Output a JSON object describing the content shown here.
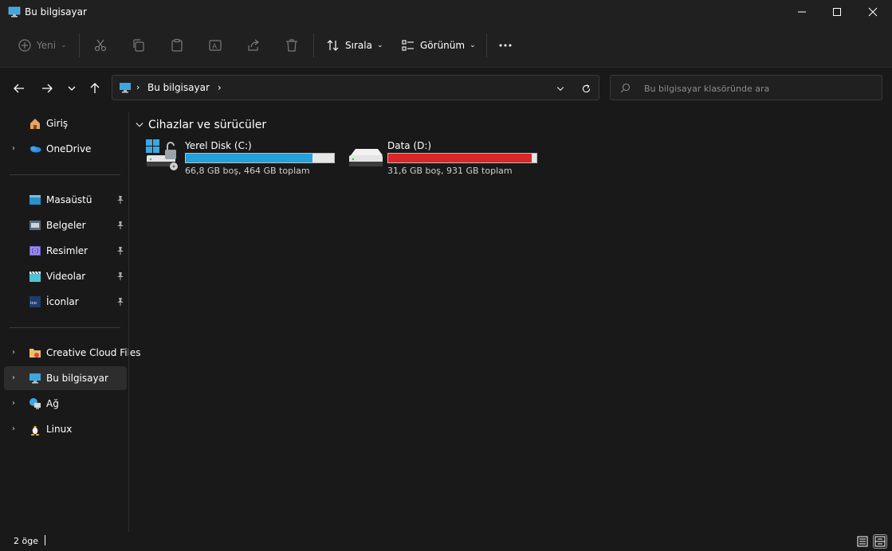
{
  "window": {
    "title": "Bu bilgisayar",
    "controls": [
      "minimize-icon",
      "maximize-icon",
      "close-icon"
    ]
  },
  "toolbar": {
    "new_label": "Yeni",
    "sort_label": "Sırala",
    "view_label": "Görünüm",
    "disabled_actions": [
      "cut-icon",
      "copy-icon",
      "paste-icon",
      "rename-icon",
      "share-icon",
      "delete-icon"
    ],
    "more_icon": "ellipsis-icon"
  },
  "address": {
    "segments": [
      "Bu bilgisayar"
    ],
    "search_placeholder": "Bu bilgisayar klasöründe ara"
  },
  "sidebar": {
    "items": [
      {
        "label": "Giriş",
        "icon": "home-icon"
      },
      {
        "label": "OneDrive",
        "icon": "onedrive-icon"
      },
      {
        "label": "Masaüstü",
        "icon": "desktop-icon",
        "pinned": true
      },
      {
        "label": "Belgeler",
        "icon": "documents-icon",
        "pinned": true
      },
      {
        "label": "Resimler",
        "icon": "pictures-icon",
        "pinned": true
      },
      {
        "label": "Videolar",
        "icon": "videos-icon",
        "pinned": true
      },
      {
        "label": "İconlar",
        "icon": "ico-folder-icon",
        "pinned": true
      },
      {
        "label": "Creative Cloud Files",
        "icon": "creative-cloud-icon"
      },
      {
        "label": "Bu bilgisayar",
        "icon": "this-pc-icon",
        "selected": true
      },
      {
        "label": "Ağ",
        "icon": "network-icon"
      },
      {
        "label": "Linux",
        "icon": "linux-icon"
      }
    ]
  },
  "content": {
    "group_title": "Cihazlar ve sürücüler",
    "drives": [
      {
        "name": "Yerel Disk (C:)",
        "info": "66,8 GB boş, 464 GB toplam",
        "used_fraction": 0.856,
        "bar_color": "#26a0da"
      },
      {
        "name": "Data (D:)",
        "info": "31,6 GB boş, 931 GB toplam",
        "used_fraction": 0.966,
        "bar_color": "#da2626"
      }
    ]
  },
  "status": {
    "item_count": "2 öge"
  }
}
